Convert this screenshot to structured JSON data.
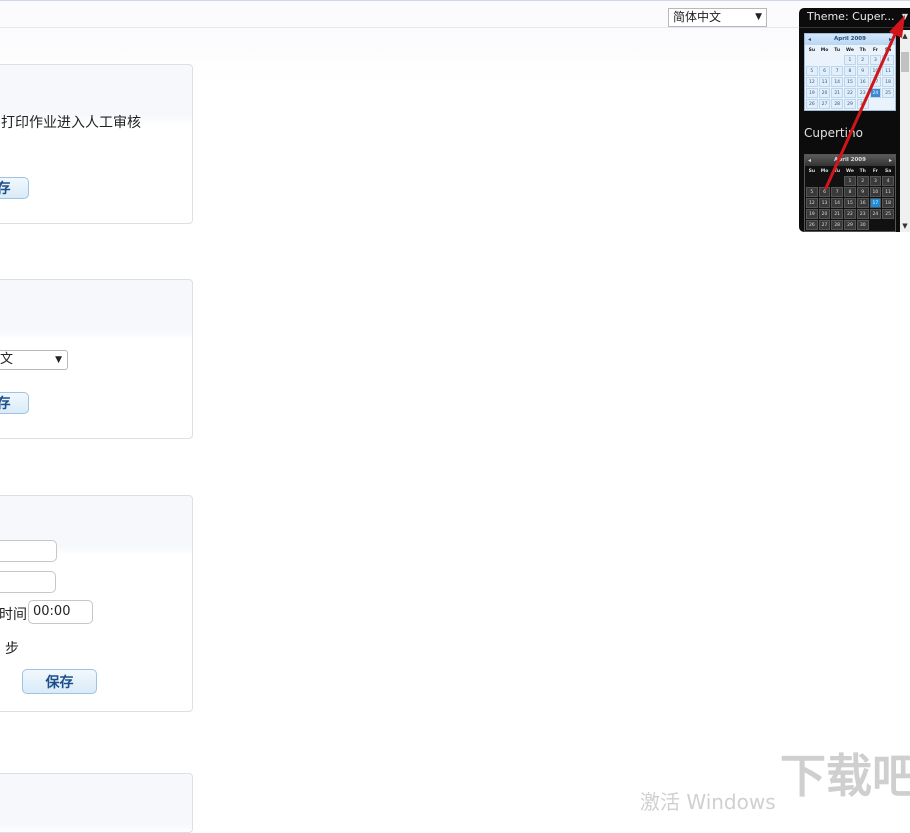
{
  "topbar": {
    "language_select": {
      "value": "简体中文"
    }
  },
  "panels": [
    {
      "text": "打印作业进入人工审核",
      "save_button": "存"
    },
    {
      "select_value": "文",
      "save_button": "存"
    },
    {
      "time_label": "时间",
      "time_value": "00:00",
      "sync_label": "步",
      "save_button": "保存"
    },
    {}
  ],
  "theme_widget": {
    "header": "Theme: Cuper...",
    "thumbnail_label": "Cupertino",
    "calendar": {
      "month": "April 2009",
      "weekdays": [
        "Su",
        "Mo",
        "Tu",
        "We",
        "Th",
        "Fr",
        "Sa"
      ],
      "weeks": [
        [
          "",
          "",
          "",
          "1",
          "2",
          "3",
          "4"
        ],
        [
          "5",
          "6",
          "7",
          "8",
          "9",
          "10",
          "11"
        ],
        [
          "12",
          "13",
          "14",
          "15",
          "16",
          "17",
          "18"
        ],
        [
          "19",
          "20",
          "21",
          "22",
          "23",
          "24",
          "25"
        ],
        [
          "26",
          "27",
          "28",
          "29",
          "30",
          "",
          ""
        ]
      ]
    }
  },
  "watermark": "激活 Windows",
  "logo_text": "下载吧",
  "colors": {
    "button_text": "#1d4f8a",
    "annotation_arrow": "#d0161b"
  }
}
